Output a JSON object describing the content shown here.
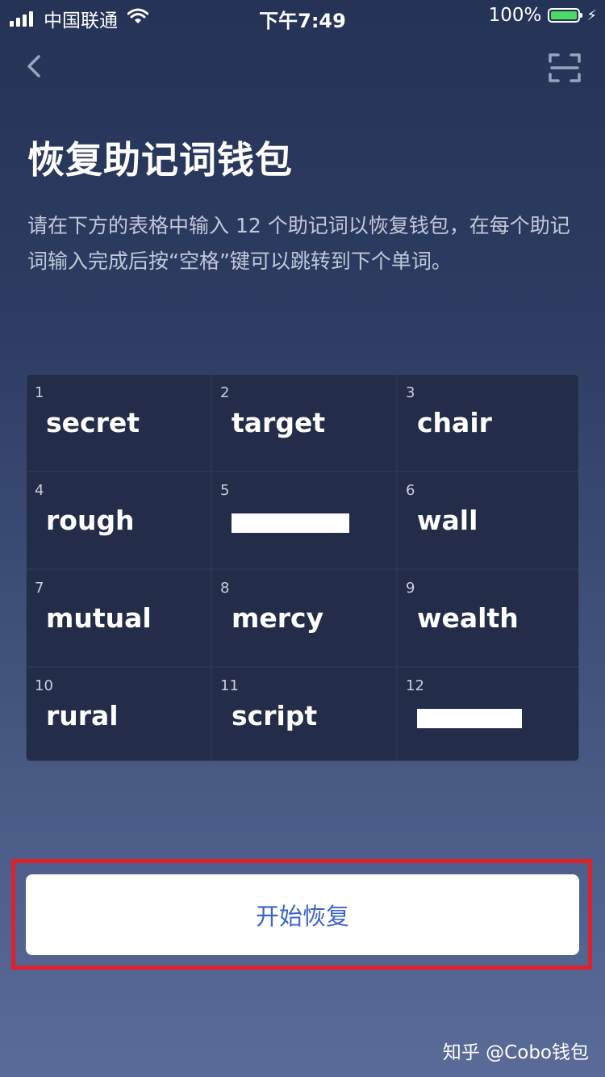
{
  "status_bar": {
    "carrier": "中国联通",
    "time": "下午7:49",
    "battery": "100%"
  },
  "header": {
    "back_icon": "chevron-left-icon",
    "scan_icon": "scan-frame-icon"
  },
  "page": {
    "title": "恢复助记词钱包",
    "description": "请在下方的表格中输入 12 个助记词以恢复钱包，在每个助记词输入完成后按“空格”键可以跳转到下个单词。"
  },
  "words": [
    {
      "index": "1",
      "word": "secret"
    },
    {
      "index": "2",
      "word": "target"
    },
    {
      "index": "3",
      "word": "chair"
    },
    {
      "index": "4",
      "word": "rough"
    },
    {
      "index": "5",
      "word": ""
    },
    {
      "index": "6",
      "word": "wall"
    },
    {
      "index": "7",
      "word": "mutual"
    },
    {
      "index": "8",
      "word": "mercy"
    },
    {
      "index": "9",
      "word": "wealth"
    },
    {
      "index": "10",
      "word": "rural"
    },
    {
      "index": "11",
      "word": "script"
    },
    {
      "index": "12",
      "word": ""
    }
  ],
  "actions": {
    "start_label": "开始恢复"
  },
  "watermark": "知乎 @Cobo钱包",
  "colors": {
    "accent": "#3d63c9",
    "highlight": "#e0202a",
    "battery": "#4cd964"
  }
}
